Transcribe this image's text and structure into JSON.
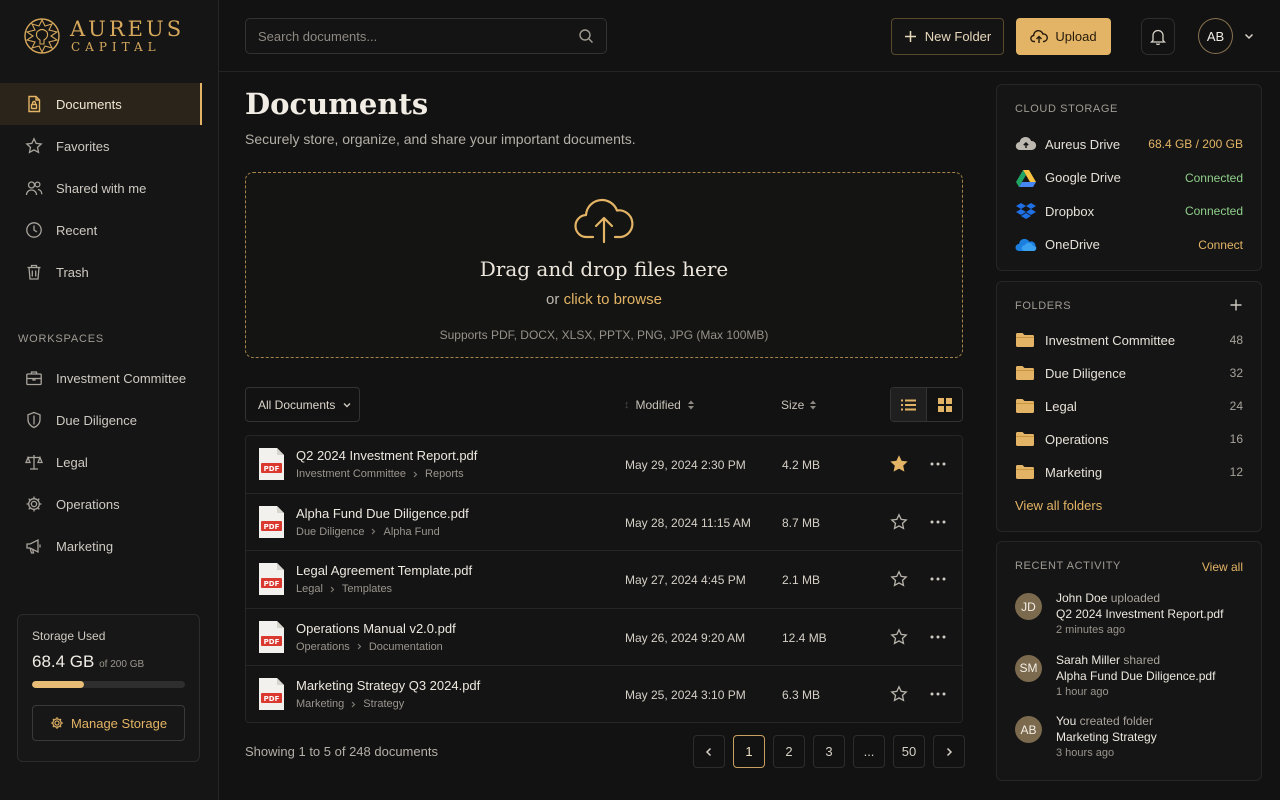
{
  "brand": {
    "line1": "AUREUS",
    "line2": "CAPITAL"
  },
  "nav": [
    {
      "label": "Documents",
      "icon": "document-lock-icon",
      "active": true
    },
    {
      "label": "Favorites",
      "icon": "star-icon"
    },
    {
      "label": "Shared with me",
      "icon": "users-icon"
    },
    {
      "label": "Recent",
      "icon": "clock-icon"
    },
    {
      "label": "Trash",
      "icon": "trash-icon"
    }
  ],
  "workspaces": {
    "title": "WORKSPACES",
    "items": [
      {
        "label": "Investment Committee",
        "icon": "briefcase-icon"
      },
      {
        "label": "Due Diligence",
        "icon": "shield-icon"
      },
      {
        "label": "Legal",
        "icon": "scales-icon"
      },
      {
        "label": "Operations",
        "icon": "gear-icon"
      },
      {
        "label": "Marketing",
        "icon": "megaphone-icon"
      }
    ]
  },
  "storage": {
    "label": "Storage Used",
    "used": "68.4 GB",
    "total": "of 200 GB",
    "fraction": 0.342,
    "manage_label": "Manage Storage"
  },
  "topbar": {
    "search_placeholder": "Search documents...",
    "new_folder_label": "New Folder",
    "upload_label": "Upload",
    "avatar_initials": "AB"
  },
  "main": {
    "title": "Documents",
    "subtitle": "Securely store, organize, and share your important documents.",
    "dropzone": {
      "title": "Drag and drop files here",
      "or": "or",
      "browse": "click to browse",
      "note": "Supports PDF, DOCX, XLSX, PPTX, PNG, JPG (Max 100MB)"
    },
    "filter_label": "All Documents",
    "col_modified": "Modified",
    "col_size": "Size",
    "files": [
      {
        "name": "Q2 2024 Investment Report.pdf",
        "path": [
          "Investment Committee",
          "Reports"
        ],
        "modified": "May 29, 2024 2:30 PM",
        "size": "4.2 MB",
        "favorite": true
      },
      {
        "name": "Alpha Fund Due Diligence.pdf",
        "path": [
          "Due Diligence",
          "Alpha Fund"
        ],
        "modified": "May 28, 2024 11:15 AM",
        "size": "8.7 MB",
        "favorite": false
      },
      {
        "name": "Legal Agreement Template.pdf",
        "path": [
          "Legal",
          "Templates"
        ],
        "modified": "May 27, 2024 4:45 PM",
        "size": "2.1 MB",
        "favorite": false
      },
      {
        "name": "Operations Manual v2.0.pdf",
        "path": [
          "Operations",
          "Documentation"
        ],
        "modified": "May 26, 2024 9:20 AM",
        "size": "12.4 MB",
        "favorite": false
      },
      {
        "name": "Marketing Strategy Q3 2024.pdf",
        "path": [
          "Marketing",
          "Strategy"
        ],
        "modified": "May 25, 2024 3:10 PM",
        "size": "6.3 MB",
        "favorite": false
      }
    ],
    "showing": "Showing 1 to 5 of 248 documents",
    "pages": [
      "1",
      "2",
      "3",
      "...",
      "50"
    ],
    "current_page": "1"
  },
  "cloud": {
    "title": "CLOUD STORAGE",
    "services": [
      {
        "name": "Aureus Drive",
        "status": "68.4 GB / 200 GB",
        "kind": "gold",
        "icon": "cloud-icon"
      },
      {
        "name": "Google Drive",
        "status": "Connected",
        "kind": "ok",
        "icon": "google-drive-icon"
      },
      {
        "name": "Dropbox",
        "status": "Connected",
        "kind": "ok",
        "icon": "dropbox-icon"
      },
      {
        "name": "OneDrive",
        "status": "Connect",
        "kind": "gold",
        "icon": "onedrive-icon"
      }
    ]
  },
  "folders": {
    "title": "FOLDERS",
    "items": [
      {
        "name": "Investment Committee",
        "count": "48"
      },
      {
        "name": "Due Diligence",
        "count": "32"
      },
      {
        "name": "Legal",
        "count": "24"
      },
      {
        "name": "Operations",
        "count": "16"
      },
      {
        "name": "Marketing",
        "count": "12"
      }
    ],
    "view_all": "View all folders"
  },
  "activity": {
    "title": "RECENT ACTIVITY",
    "view_all": "View all",
    "items": [
      {
        "initials": "JD",
        "who": "John Doe",
        "verb": "uploaded",
        "target": "Q2 2024 Investment Report.pdf",
        "time": "2 minutes ago"
      },
      {
        "initials": "SM",
        "who": "Sarah Miller",
        "verb": "shared",
        "target": "Alpha Fund Due Diligence.pdf",
        "time": "1 hour ago"
      },
      {
        "initials": "AB",
        "who": "You",
        "verb": "created folder",
        "target": "Marketing Strategy",
        "time": "3 hours ago"
      }
    ]
  },
  "colors": {
    "accent": "#e3b465",
    "background": "#121212",
    "connected": "#8fcf8a"
  }
}
